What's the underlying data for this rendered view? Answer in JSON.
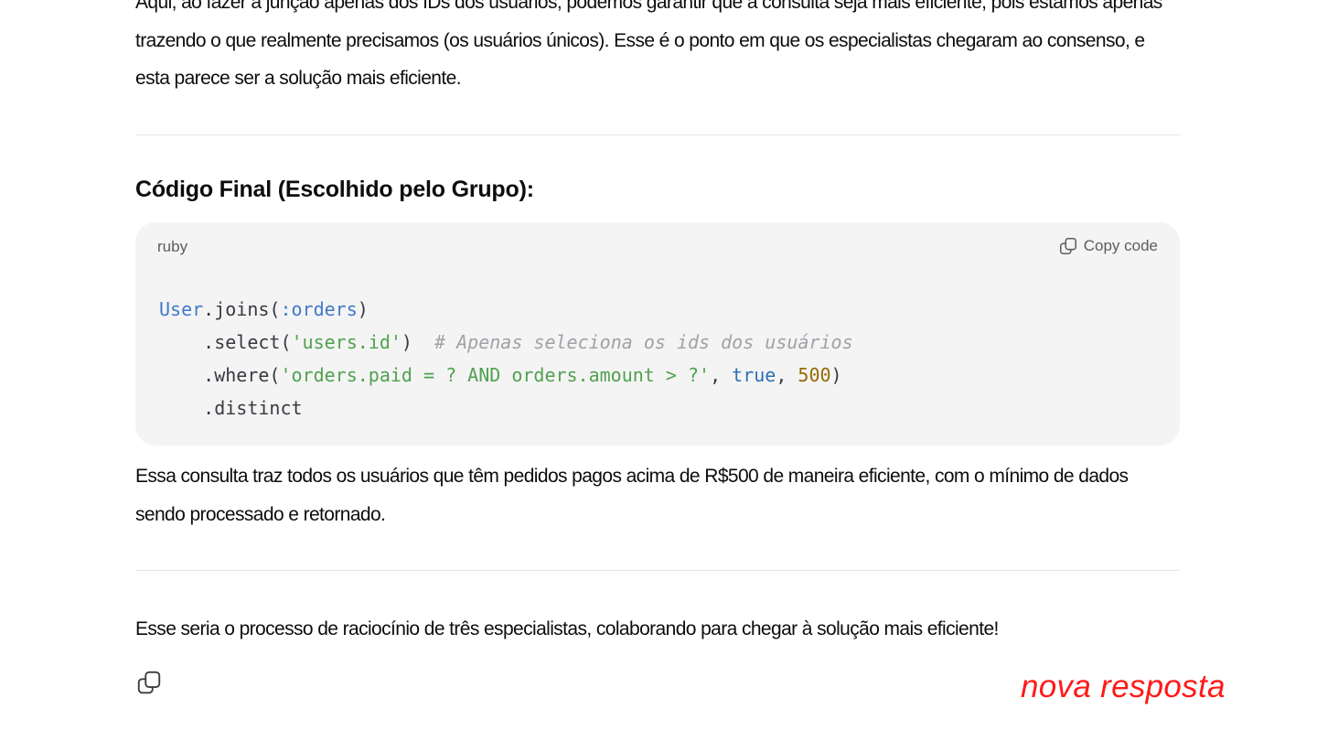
{
  "message": {
    "intro_paragraph": "Aqui, ao fazer a junção apenas dos IDs dos usuários, podemos garantir que a consulta seja mais eficiente, pois estamos apenas trazendo o que realmente precisamos (os usuários únicos). Esse é o ponto em que os especialistas chegaram ao consenso, e esta parece ser a solução mais eficiente.",
    "heading": "Código Final (Escolhido pelo Grupo):",
    "code_block": {
      "language": "ruby",
      "copy_label": "Copy code",
      "copy_icon": "copy-icon",
      "lines": [
        [
          {
            "t": "User",
            "c": "const"
          },
          {
            "t": ".joins(",
            "c": "plain"
          },
          {
            "t": ":orders",
            "c": "sym"
          },
          {
            "t": ")",
            "c": "plain"
          }
        ],
        [
          {
            "t": "    .select(",
            "c": "plain"
          },
          {
            "t": "'users.id'",
            "c": "str"
          },
          {
            "t": ")  ",
            "c": "plain"
          },
          {
            "t": "# Apenas seleciona os ids dos usuários",
            "c": "com"
          }
        ],
        [
          {
            "t": "    .where(",
            "c": "plain"
          },
          {
            "t": "'orders.paid = ? AND orders.amount > ?'",
            "c": "str"
          },
          {
            "t": ", ",
            "c": "plain"
          },
          {
            "t": "true",
            "c": "bool"
          },
          {
            "t": ", ",
            "c": "plain"
          },
          {
            "t": "500",
            "c": "num"
          },
          {
            "t": ")",
            "c": "plain"
          }
        ],
        [
          {
            "t": "    .distinct",
            "c": "plain"
          }
        ]
      ],
      "colors": {
        "const": "#4078c8",
        "sym": "#4078c8",
        "str": "#50a14f",
        "bool": "#2f6fb5",
        "num": "#986801",
        "com": "#a0a1a7"
      }
    },
    "after_code_paragraph": "Essa consulta traz todos os usuários que têm pedidos pagos acima de R$500 de maneira eficiente, com o mínimo de dados sendo processado e retornado.",
    "closing_paragraph": "Esse seria o processo de raciocínio de três especialistas, colaborando para chegar à solução mais eficiente!",
    "actions": {
      "copy_icon": "copy-icon"
    }
  },
  "annotation": {
    "text": "nova resposta",
    "color": "#ff1a1a"
  }
}
